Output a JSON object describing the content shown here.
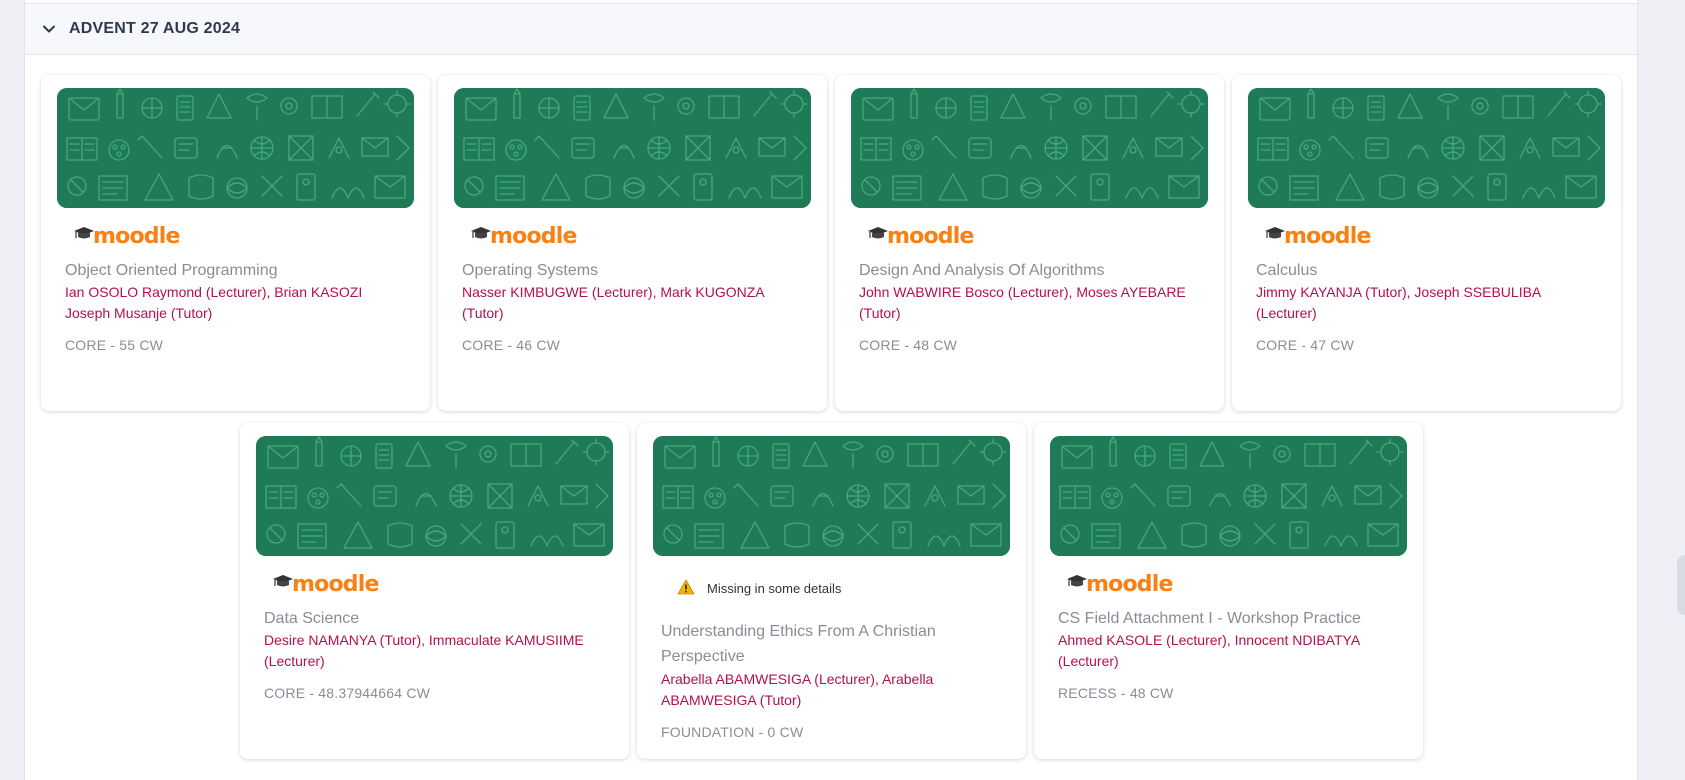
{
  "section": {
    "title": "ADVENT 27 AUG 2024",
    "expanded": true
  },
  "logo_text": "moodle",
  "colors": {
    "banner": "#1f7a58",
    "moodle_orange": "#f98012",
    "lecturer_text": "#b5104d",
    "muted_text": "#8a8d96"
  },
  "courses": [
    {
      "title": "Object Oriented Programming",
      "lecturers": "Ian OSOLO Raymond (Lecturer), Brian KASOZI Joseph Musanje (Tutor)",
      "meta": "CORE - 55 CW",
      "source": "moodle"
    },
    {
      "title": "Operating Systems",
      "lecturers": "Nasser KIMBUGWE (Lecturer), Mark KUGONZA (Tutor)",
      "meta": "CORE - 46 CW",
      "source": "moodle"
    },
    {
      "title": "Design And Analysis Of Algorithms",
      "lecturers": "John WABWIRE Bosco (Lecturer), Moses AYEBARE (Tutor)",
      "meta": "CORE - 48 CW",
      "source": "moodle"
    },
    {
      "title": "Calculus",
      "lecturers": "Jimmy KAYANJA (Tutor), Joseph SSEBULIBA (Lecturer)",
      "meta": "CORE - 47 CW",
      "source": "moodle"
    },
    {
      "title": "Data Science",
      "lecturers": "Desire NAMANYA (Tutor), Immaculate KAMUSIIME (Lecturer)",
      "meta": "CORE - 48.37944664 CW",
      "source": "moodle"
    },
    {
      "title": "Understanding Ethics From A Christian Perspective",
      "lecturers": "Arabella ABAMWESIGA (Lecturer), Arabella ABAMWESIGA (Tutor)",
      "meta": "FOUNDATION - 0 CW",
      "source": "warning",
      "warning": "Missing in some details"
    },
    {
      "title": "CS Field Attachment I - Workshop Practice",
      "lecturers": "Ahmed KASOLE (Lecturer), Innocent NDIBATYA (Lecturer)",
      "meta": "RECESS - 48 CW",
      "source": "moodle"
    }
  ]
}
